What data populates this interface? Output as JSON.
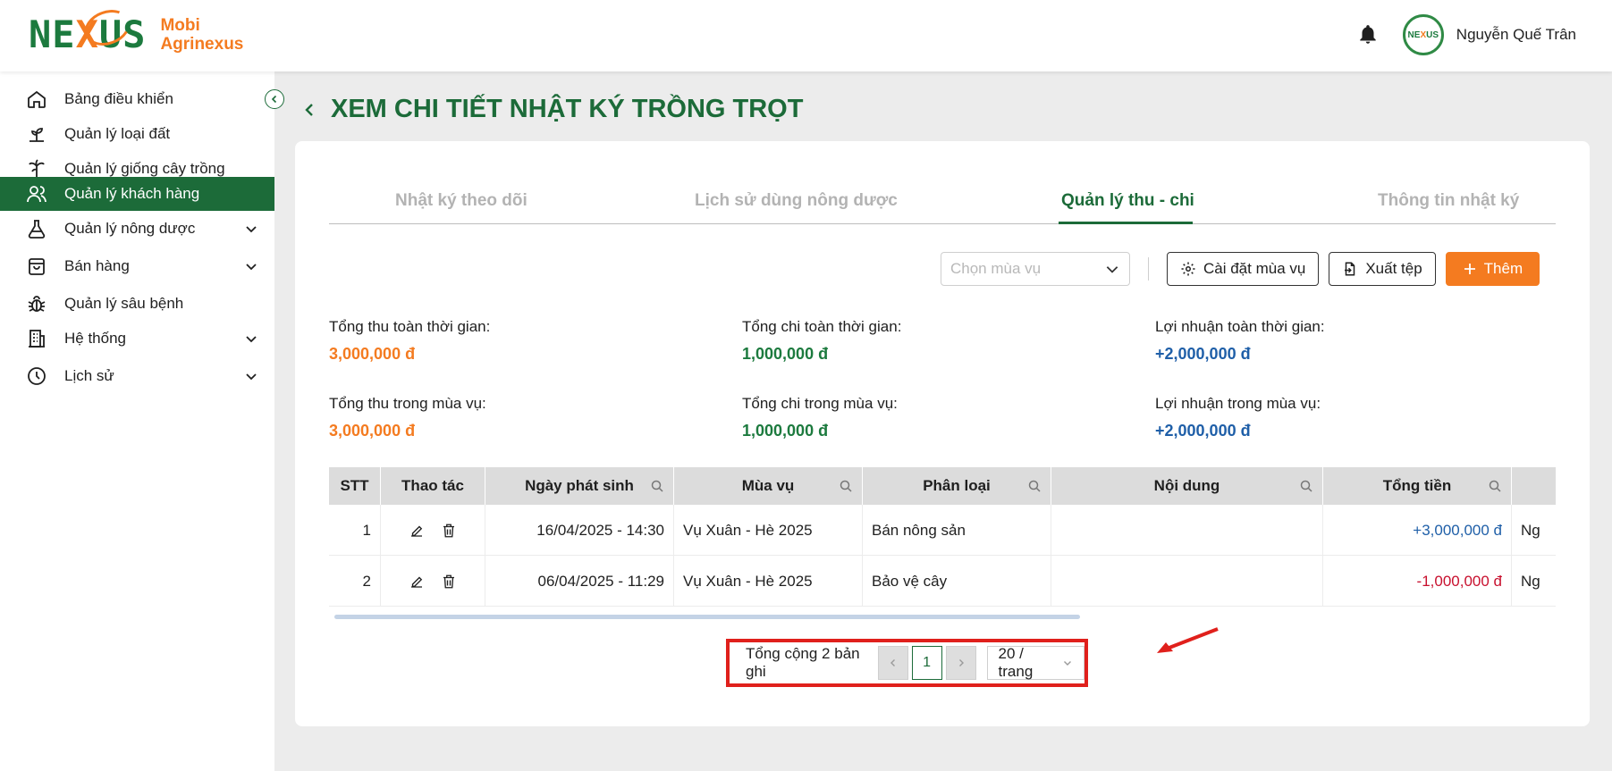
{
  "header": {
    "logo_word_left": "NE",
    "logo_word_x": "X",
    "logo_word_right": "US",
    "logo_line1": "Mobi",
    "logo_line2": "Agrinexus",
    "avatar_left": "NE",
    "avatar_x": "X",
    "avatar_right": "US",
    "username": "Nguyễn Quế Trân"
  },
  "sidebar": {
    "items": [
      {
        "label": "Bảng điều khiển",
        "icon": "home-icon"
      },
      {
        "label": "Quản lý loại đất",
        "icon": "sprout-icon"
      },
      {
        "label": "Quản lý giống cây trồng",
        "icon": "plant-icon"
      },
      {
        "label": "Quản lý khách hàng",
        "icon": "users-icon",
        "active": true
      },
      {
        "label": "Quản lý nông dược",
        "icon": "flask-icon",
        "expandable": true
      },
      {
        "label": "Bán hàng",
        "icon": "bag-icon",
        "expandable": true
      },
      {
        "label": "Quản lý sâu bệnh",
        "icon": "bug-icon"
      },
      {
        "label": "Hệ thống",
        "icon": "building-icon",
        "expandable": true
      },
      {
        "label": "Lịch sử",
        "icon": "clock-icon",
        "expandable": true
      }
    ]
  },
  "main": {
    "title": "XEM CHI TIẾT NHẬT KÝ TRỒNG TRỌT",
    "tabs": [
      {
        "label": "Nhật ký theo dõi"
      },
      {
        "label": "Lịch sử dùng nông dược"
      },
      {
        "label": "Quản lý thu - chi",
        "active": true
      },
      {
        "label": "Thông tin nhật ký"
      }
    ],
    "toolbar": {
      "season_placeholder": "Chọn mùa vụ",
      "settings_label": "Cài đặt mùa vụ",
      "export_label": "Xuất tệp",
      "add_label": "Thêm"
    },
    "stats": {
      "total_income_all_label": "Tổng thu toàn thời gian:",
      "total_income_all_value": "3,000,000 đ",
      "total_expense_all_label": "Tổng chi toàn thời gian:",
      "total_expense_all_value": "1,000,000 đ",
      "profit_all_label": "Lợi nhuận toàn thời gian:",
      "profit_all_value": "+2,000,000 đ",
      "total_income_season_label": "Tổng thu trong mùa vụ:",
      "total_income_season_value": "3,000,000 đ",
      "total_expense_season_label": "Tổng chi trong mùa vụ:",
      "total_expense_season_value": "1,000,000 đ",
      "profit_season_label": "Lợi nhuận trong mùa vụ:",
      "profit_season_value": "+2,000,000 đ"
    },
    "table": {
      "columns": [
        "STT",
        "Thao tác",
        "Ngày phát sinh",
        "Mùa vụ",
        "Phân loại",
        "Nội dung",
        "Tổng tiền"
      ],
      "rows": [
        {
          "stt": "1",
          "date": "16/04/2025 - 14:30",
          "season": "Vụ Xuân - Hè 2025",
          "category": "Bán nông sản",
          "content": "",
          "amount": "+3,000,000 đ",
          "extra": "Ng"
        },
        {
          "stt": "2",
          "date": "06/04/2025 - 11:29",
          "season": "Vụ Xuân - Hè 2025",
          "category": "Bảo vệ cây",
          "content": "",
          "amount": "-1,000,000 đ",
          "extra": "Ng"
        }
      ]
    },
    "pagination": {
      "total_text": "Tổng cộng 2 bản ghi",
      "current_page": "1",
      "page_size": "20 / trang"
    }
  },
  "colors": {
    "brand_green": "#1c6b39",
    "accent_orange": "#f47b20",
    "positive_blue": "#1f5fa8",
    "negative_red": "#c8102e",
    "annotation_red": "#e0201c"
  }
}
